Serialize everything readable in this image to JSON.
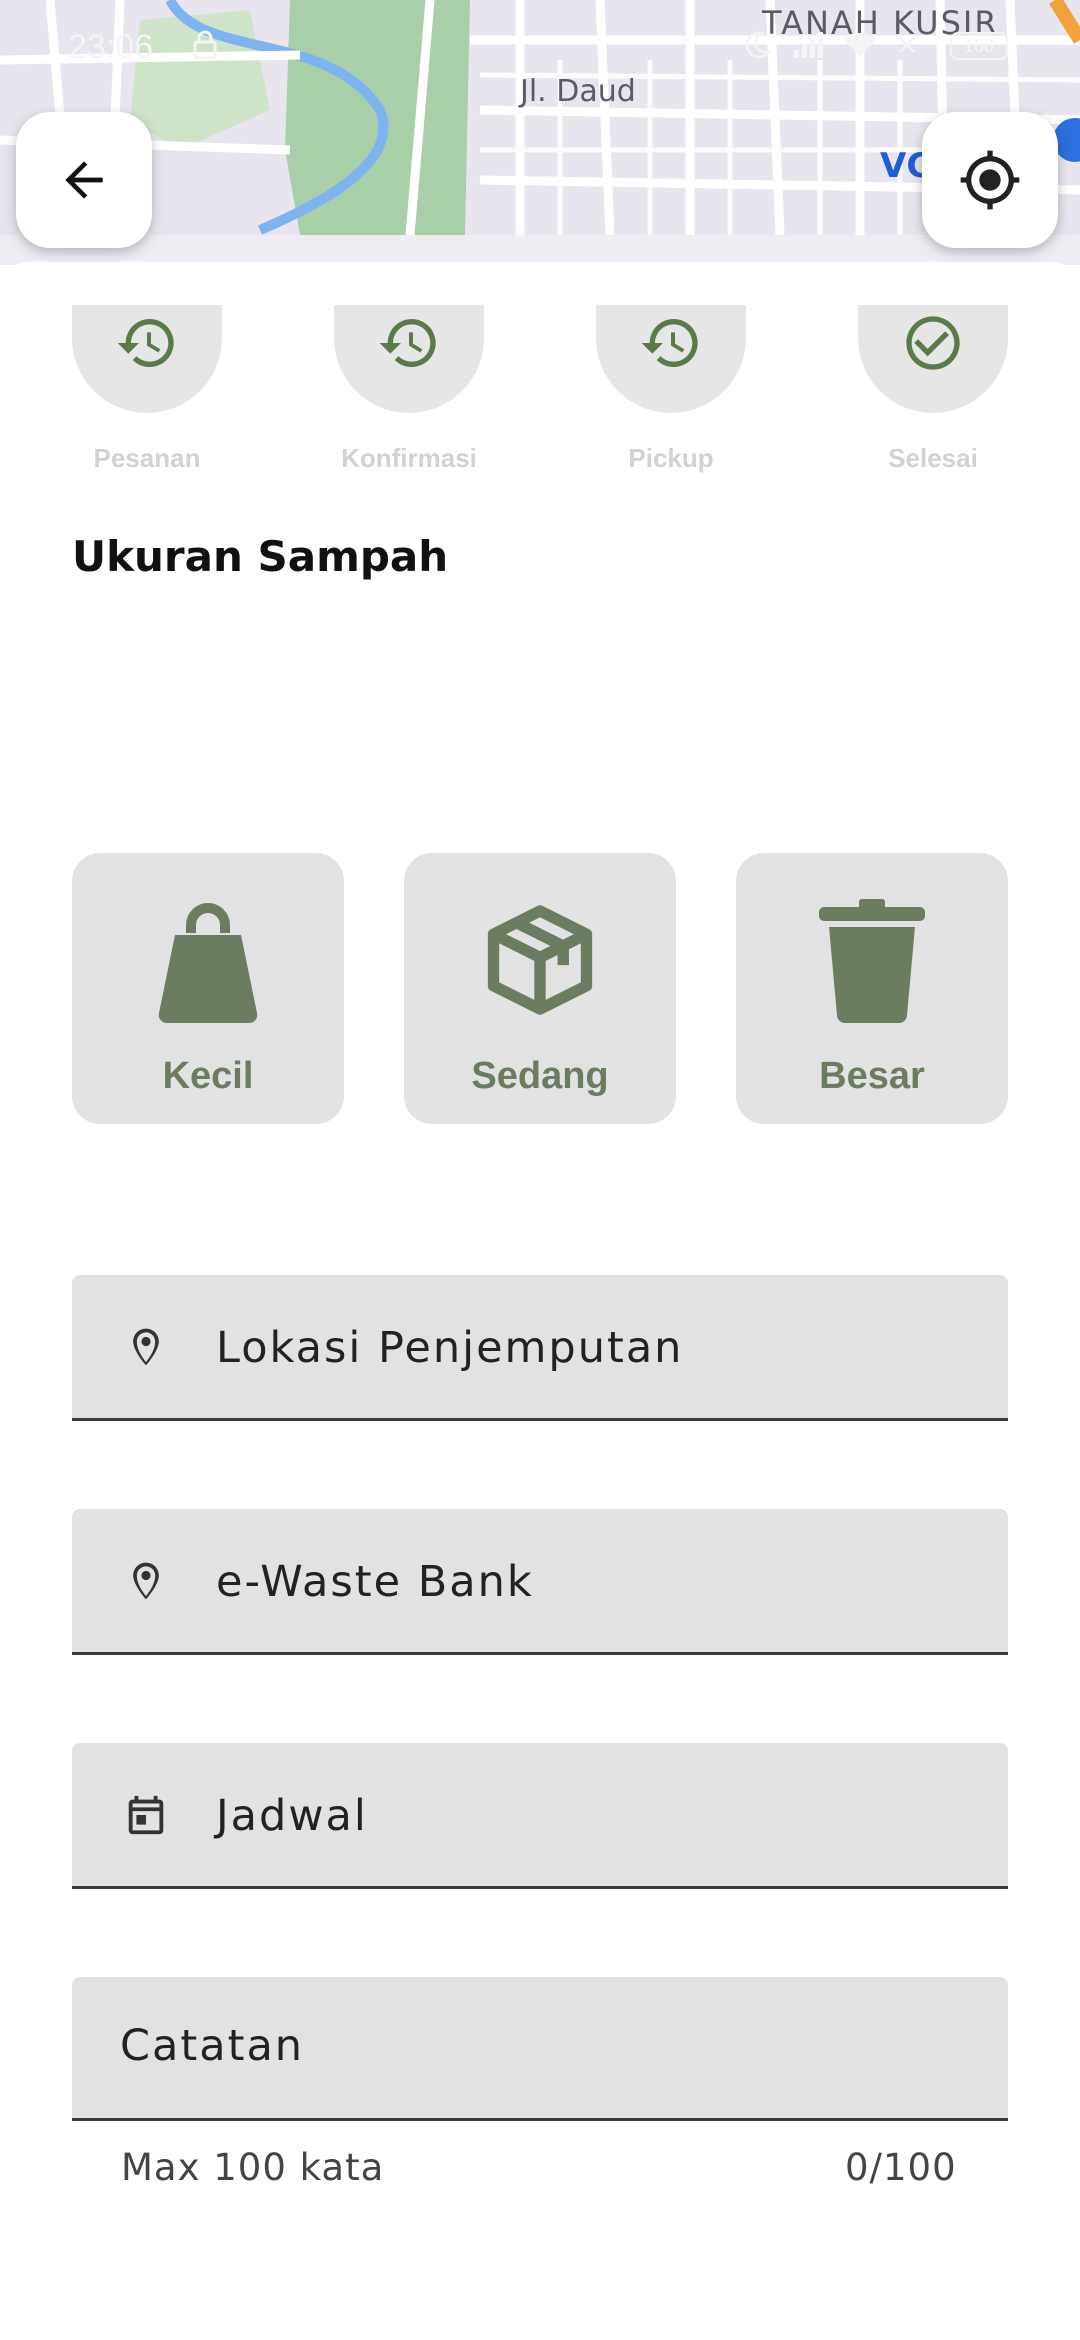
{
  "status_bar": {
    "time": "23:06",
    "battery": "100",
    "icons": [
      "lock-icon",
      "moon-icon",
      "signal-icon",
      "wifi-icon",
      "close-icon",
      "battery-icon"
    ]
  },
  "map": {
    "area_label": "TANAH KUSIR",
    "road_label": "Jl. Daud",
    "partial_label": "VC"
  },
  "header": {
    "back_icon": "arrow-left-icon",
    "locate_icon": "my-location-icon"
  },
  "steps": [
    {
      "label": "Pesanan",
      "icon": "history-icon"
    },
    {
      "label": "Konfirmasi",
      "icon": "history-icon"
    },
    {
      "label": "Pickup",
      "icon": "history-icon"
    },
    {
      "label": "Selesai",
      "icon": "check-circle-icon"
    }
  ],
  "size_section": {
    "title": "Ukuran Sampah",
    "options": [
      {
        "label": "Kecil",
        "icon": "bag-icon"
      },
      {
        "label": "Sedang",
        "icon": "box-icon"
      },
      {
        "label": "Besar",
        "icon": "trash-icon"
      }
    ]
  },
  "form": {
    "pickup_location": {
      "placeholder": "Lokasi Penjemputan",
      "icon": "location-pin-icon"
    },
    "waste_bank": {
      "placeholder": "e-Waste Bank",
      "icon": "location-pin-icon"
    },
    "schedule": {
      "placeholder": "Jadwal",
      "icon": "calendar-icon"
    },
    "notes": {
      "placeholder": "Catatan",
      "helper": "Max 100 kata",
      "counter": "0/100"
    }
  },
  "colors": {
    "accent": "#6b7c60",
    "icon_green": "#5a7a4a",
    "card_bg": "#e2e2e2",
    "step_label": "#d2d2d2"
  }
}
